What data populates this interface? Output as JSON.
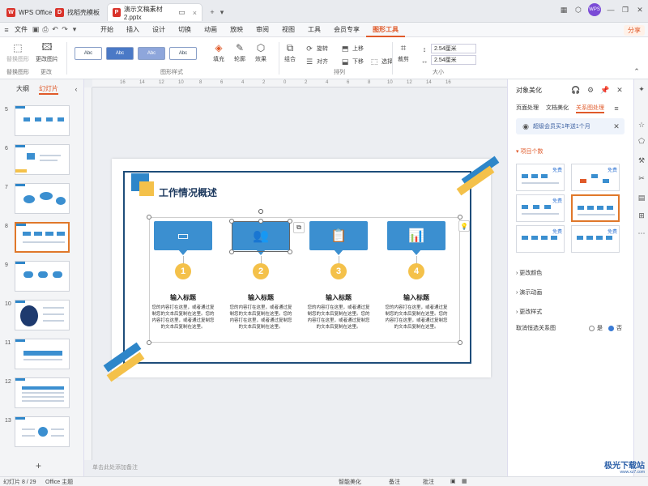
{
  "titlebar": {
    "tabs": [
      {
        "label": "WPS Office"
      },
      {
        "label": "找稻壳模板"
      },
      {
        "label": "演示文稿素材2.pptx"
      }
    ],
    "user_initials": "WPS"
  },
  "menubar": {
    "file": "文件",
    "items": [
      "开始",
      "插入",
      "设计",
      "切换",
      "动画",
      "放映",
      "审阅",
      "视图",
      "工具",
      "会员专享",
      "图形工具"
    ],
    "share": "分享"
  },
  "ribbon": {
    "replace_shape": "替换图形",
    "change_picture": "更改图片",
    "group_replace": "替换图形",
    "group_change": "更改",
    "style_samples": [
      "Abc",
      "Abc",
      "Abc",
      "Abc"
    ],
    "group_style": "图形样式",
    "fill": "填充",
    "outline": "轮廓",
    "effect": "效果",
    "combine": "组合",
    "rotate": "旋转",
    "align": "对齐",
    "bring_up": "上移",
    "send_down": "下移",
    "select": "选择",
    "group_arrange": "排列",
    "crop": "裁剪",
    "height_value": "2.54厘米",
    "width_value": "2.54厘米",
    "group_size": "大小"
  },
  "leftpanel": {
    "tab_outline": "大纲",
    "tab_slides": "幻灯片",
    "slide_numbers": [
      "5",
      "6",
      "7",
      "8",
      "9",
      "10",
      "11",
      "12",
      "13"
    ],
    "selected_slide": "8"
  },
  "ruler": {
    "marks": [
      "16",
      "14",
      "12",
      "10",
      "8",
      "6",
      "4",
      "2",
      "0",
      "2",
      "4",
      "6",
      "8",
      "10",
      "12",
      "14",
      "16"
    ]
  },
  "slide": {
    "title": "工作情况概述",
    "cards": [
      {
        "number": "1",
        "title": "输入标题",
        "text": "您的内容打在这里，或者通过复制您的文本后复制在这里。您的内容打在这里，或者通过复制您的文本后复制在这里。"
      },
      {
        "number": "2",
        "title": "输入标题",
        "text": "您的内容打在这里，或者通过复制您的文本后复制在这里。您的内容打在这里，或者通过复制您的文本后复制在这里。"
      },
      {
        "number": "3",
        "title": "输入标题",
        "text": "您的内容打在这里，或者通过复制您的文本后复制在这里。您的内容打在这里，或者通过复制您的文本后复制在这里。"
      },
      {
        "number": "4",
        "title": "输入标题",
        "text": "您的内容打在这里，或者通过复制您的文本后复制在这里。您的内容打在这里，或者通过复制您的文本后复制在这里。"
      }
    ],
    "notes_placeholder": "单击此处添加备注"
  },
  "rightpanel": {
    "title": "对象美化",
    "tabs": [
      "页面处理",
      "文档美化",
      "关系图处理"
    ],
    "promo": "超级会员买1年送1个月",
    "section_count": "项目个数",
    "free_label": "免费",
    "change_color": "更改颜色",
    "show_animation": "演示动画",
    "change_style": "更改样式",
    "cancel_rel": "取消恒选关系图",
    "yes": "是",
    "no": "否"
  },
  "statusbar": {
    "slide_counter": "幻灯片 8 / 29",
    "theme": "Office 主题",
    "smart_beautify": "智能美化",
    "notes": "备注",
    "comments": "批注"
  },
  "watermark": {
    "brand": "极光下载站",
    "url": "www.xz7.com"
  },
  "colors": {
    "accent": "#e05a2a",
    "slide_blue": "#3b8fd0",
    "slide_yellow": "#f4c14a",
    "frame_navy": "#1e4d7a"
  }
}
